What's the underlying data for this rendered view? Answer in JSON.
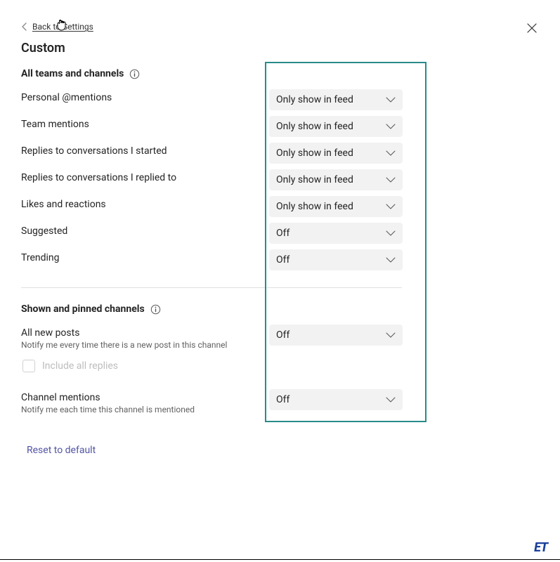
{
  "back_label": "Back to Settings",
  "title": "Custom",
  "section1": {
    "header": "All teams and channels",
    "rows": [
      {
        "label": "Personal @mentions",
        "value": "Only show in feed"
      },
      {
        "label": "Team mentions",
        "value": "Only show in feed"
      },
      {
        "label": "Replies to conversations I started",
        "value": "Only show in feed"
      },
      {
        "label": "Replies to conversations I replied to",
        "value": "Only show in feed"
      },
      {
        "label": "Likes and reactions",
        "value": "Only show in feed"
      },
      {
        "label": "Suggested",
        "value": "Off"
      },
      {
        "label": "Trending",
        "value": "Off"
      }
    ]
  },
  "section2": {
    "header": "Shown and pinned channels",
    "all_new_posts": {
      "label": "All new posts",
      "sub": "Notify me every time there is a new post in this channel",
      "value": "Off"
    },
    "include_replies": "Include all replies",
    "channel_mentions": {
      "label": "Channel mentions",
      "sub": "Notify me each time this channel is mentioned",
      "value": "Off"
    }
  },
  "reset_label": "Reset to default",
  "watermark": "ET"
}
